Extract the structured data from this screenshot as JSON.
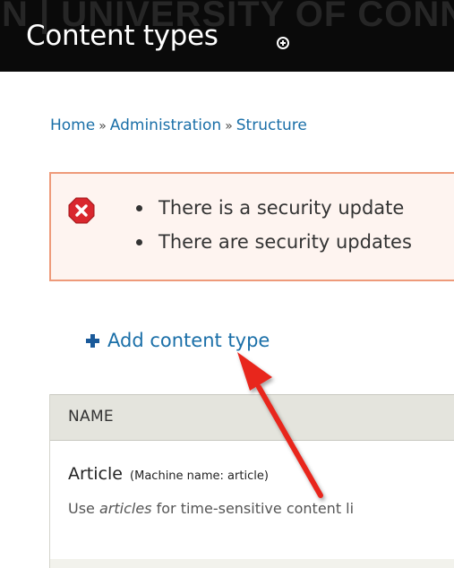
{
  "header": {
    "watermark": "N | UNIVERSITY OF CONN",
    "title": "Content types"
  },
  "breadcrumb": {
    "items": [
      "Home",
      "Administration",
      "Structure"
    ],
    "separator": "»"
  },
  "messages": {
    "type": "error",
    "items": [
      "There is a security update",
      "There are security updates"
    ]
  },
  "actions": {
    "add_content_type": "Add content type"
  },
  "table": {
    "header_name": "NAME",
    "rows": [
      {
        "name": "Article",
        "machine_name": "(Machine name: article)",
        "desc_prefix": "Use ",
        "desc_em": "articles",
        "desc_suffix": " for time-sensitive content li"
      }
    ]
  },
  "colors": {
    "link": "#1a6fa8",
    "header_bg": "#0a0a0a",
    "error_border": "#ee9a7a",
    "error_bg": "#fef4f0",
    "error_icon": "#d9272e",
    "arrow": "#e8251f"
  },
  "icons": {
    "title_action": "add-circle-icon",
    "message": "error-icon",
    "add": "plus-icon"
  }
}
